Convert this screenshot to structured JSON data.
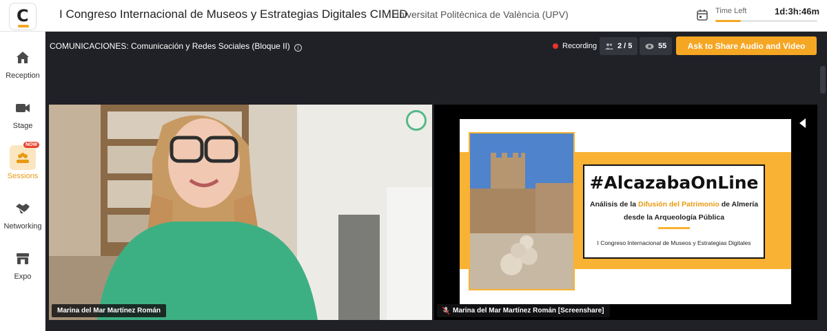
{
  "header": {
    "event_title": "I Congreso Internacional de Museos y Estrategias Digitales CIMED",
    "organizer": "Universitat Politècnica de València (UPV)",
    "time_left_label": "Time Left",
    "time_left_value": "1d:3h:46m",
    "time_progress": 0.25,
    "logo_letter": "C",
    "calendar_icon": "calendar-icon"
  },
  "sidebar": {
    "items": [
      {
        "label": "Reception",
        "icon": "home-icon"
      },
      {
        "label": "Stage",
        "icon": "video-camera-icon"
      },
      {
        "label": "Sessions",
        "icon": "sessions-icon",
        "badge": "NOW",
        "active": true
      },
      {
        "label": "Networking",
        "icon": "handshake-icon"
      },
      {
        "label": "Expo",
        "icon": "store-icon"
      }
    ]
  },
  "session": {
    "title": "COMUNICACIONES: Comunicación y Redes Sociales (Bloque II)",
    "info_icon": "i",
    "recording_label": "Recording",
    "attendees": "2 / 5",
    "views": "55",
    "ask_button_label": "Ask to Share Audio and Video"
  },
  "tiles": [
    {
      "name": "Marina del Mar Martínez Román"
    },
    {
      "name": "Marina del Mar Martínez Román [Screenshare]"
    }
  ],
  "slide": {
    "hashtag": "#AlcazabaOnLine",
    "line1_pre": "Análisis de la",
    "line1_highlight": "Difusión del Patrimonio",
    "line1_post": "de Almería",
    "line2": "desde la Arqueología Pública",
    "congress": "I Congreso Internacional de Museos y Estrategias Digitales"
  },
  "colors": {
    "accent": "#f5a623",
    "stage_bg": "#1f2126",
    "recording": "#e8342a",
    "speaker_ring": "#56b887"
  }
}
